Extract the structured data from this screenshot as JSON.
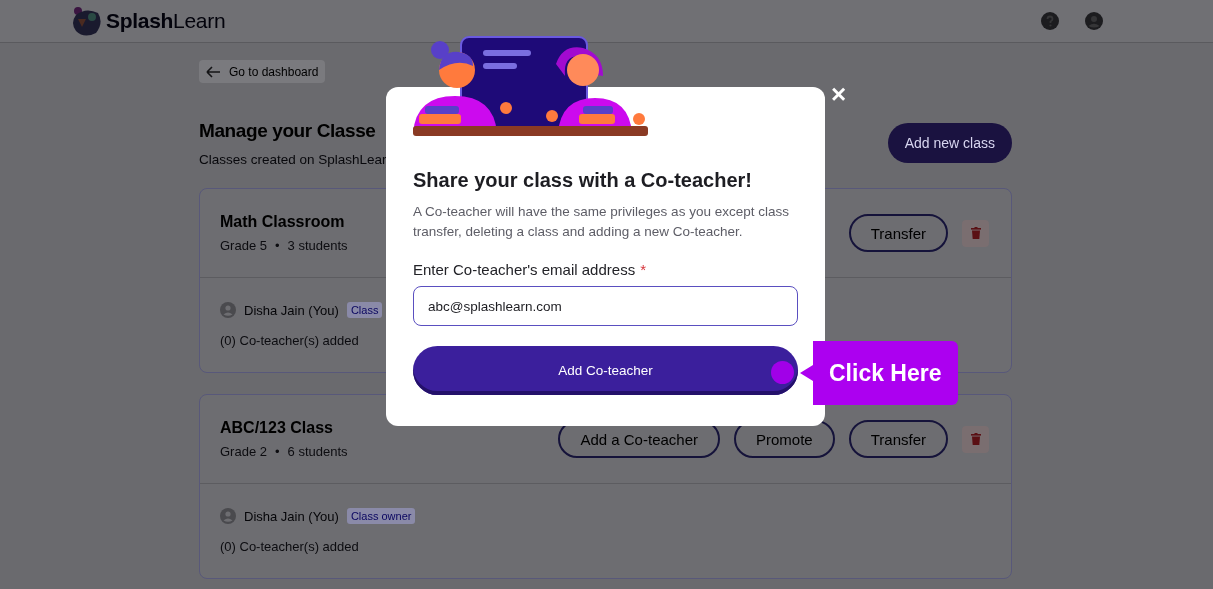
{
  "header": {
    "logo": "**Splash**Learn"
  },
  "back_link": {
    "label": "Go to dashboard"
  },
  "page": {
    "title": "Manage your Classe",
    "subtitle": "Classes created on SplashLear",
    "add_button": "Add new class"
  },
  "classes": [
    {
      "name": "Math Classroom",
      "grade": "Grade 5",
      "separator": "•",
      "students": "3 students",
      "owner": "Disha Jain (You)",
      "owner_tag": "Class",
      "coteachers": "(0) Co-teacher(s) added",
      "actions": [
        "Transfer"
      ]
    },
    {
      "name": "ABC/123 Class",
      "grade": "Grade 2",
      "separator": "•",
      "students": "6 students",
      "owner": "Disha Jain (You)",
      "owner_tag": "Class owner",
      "coteachers": "(0) Co-teacher(s) added",
      "actions": [
        "Add a Co-teacher",
        "Promote",
        "Transfer"
      ]
    }
  ],
  "modal": {
    "title": "Share your class with a Co-teacher!",
    "description": "A Co-teacher will have the same privileges as you except class transfer, deleting a class and adding a new Co-teacher.",
    "field_label": "Enter Co-teacher's email address",
    "required_mark": "*",
    "field_value": "abc@splashlearn.com",
    "submit": "Add Co-teacher",
    "close": "×"
  },
  "callout": {
    "label": "Click Here"
  }
}
